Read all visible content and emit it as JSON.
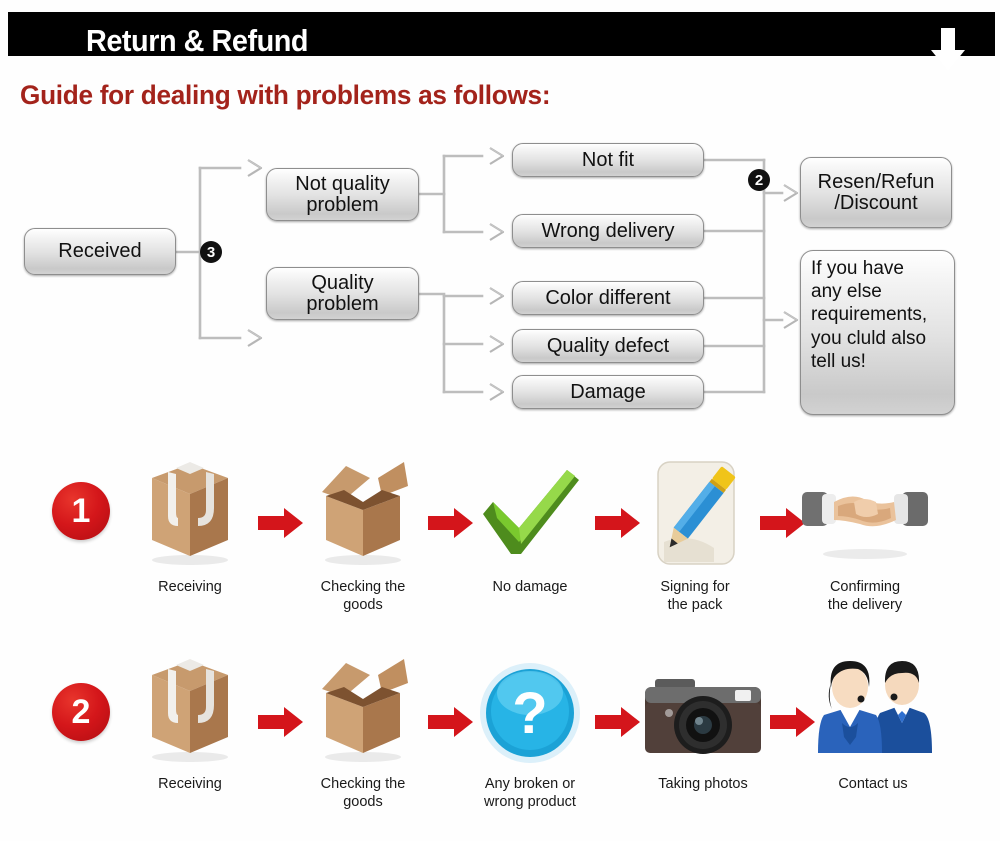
{
  "header": {
    "title": "Return & Refund",
    "down_arrow_icon": "arrow-down-icon",
    "background_color": "#000000",
    "text_color": "#ffffff"
  },
  "guide": {
    "heading": "Guide for dealing with problems as follows:",
    "color": "#A3231B"
  },
  "flowchart": {
    "start": {
      "label": "Received"
    },
    "badge_3": "3",
    "badge_2": "2",
    "branches": [
      {
        "label": "Not quality problem",
        "line1": "Not quality",
        "line2": "problem"
      },
      {
        "label": "Quality problem",
        "line1": "Quality",
        "line2": "problem"
      }
    ],
    "issues": [
      {
        "label": "Not fit"
      },
      {
        "label": "Wrong delivery"
      },
      {
        "label": "Color different"
      },
      {
        "label": "Quality defect"
      },
      {
        "label": "Damage"
      }
    ],
    "outcomes": [
      {
        "line1": "Resen/Refun",
        "line2": "/Discount"
      }
    ],
    "note": {
      "lines": [
        "If you have",
        "any else",
        "requirements,",
        "you cluld also",
        "tell us!"
      ]
    }
  },
  "process": {
    "rows": [
      {
        "number": "1",
        "steps": [
          {
            "icon": "closed-box-icon",
            "caption": "Receiving"
          },
          {
            "icon": "open-box-icon",
            "caption": "Checking the\ngoods"
          },
          {
            "icon": "green-check-icon",
            "caption": "No damage"
          },
          {
            "icon": "pencil-signing-icon",
            "caption": "Signing for\nthe pack"
          },
          {
            "icon": "handshake-icon",
            "caption": "Confirming\nthe delivery"
          }
        ]
      },
      {
        "number": "2",
        "steps": [
          {
            "icon": "closed-box-icon",
            "caption": "Receiving"
          },
          {
            "icon": "open-box-icon",
            "caption": "Checking the\ngoods"
          },
          {
            "icon": "question-mark-icon",
            "caption": "Any broken or\nwrong product"
          },
          {
            "icon": "camera-icon",
            "caption": "Taking photos"
          },
          {
            "icon": "support-agents-icon",
            "caption": "Contact us"
          }
        ]
      }
    ],
    "arrow_icon": "arrow-right-icon",
    "arrow_color": "#d81515"
  }
}
